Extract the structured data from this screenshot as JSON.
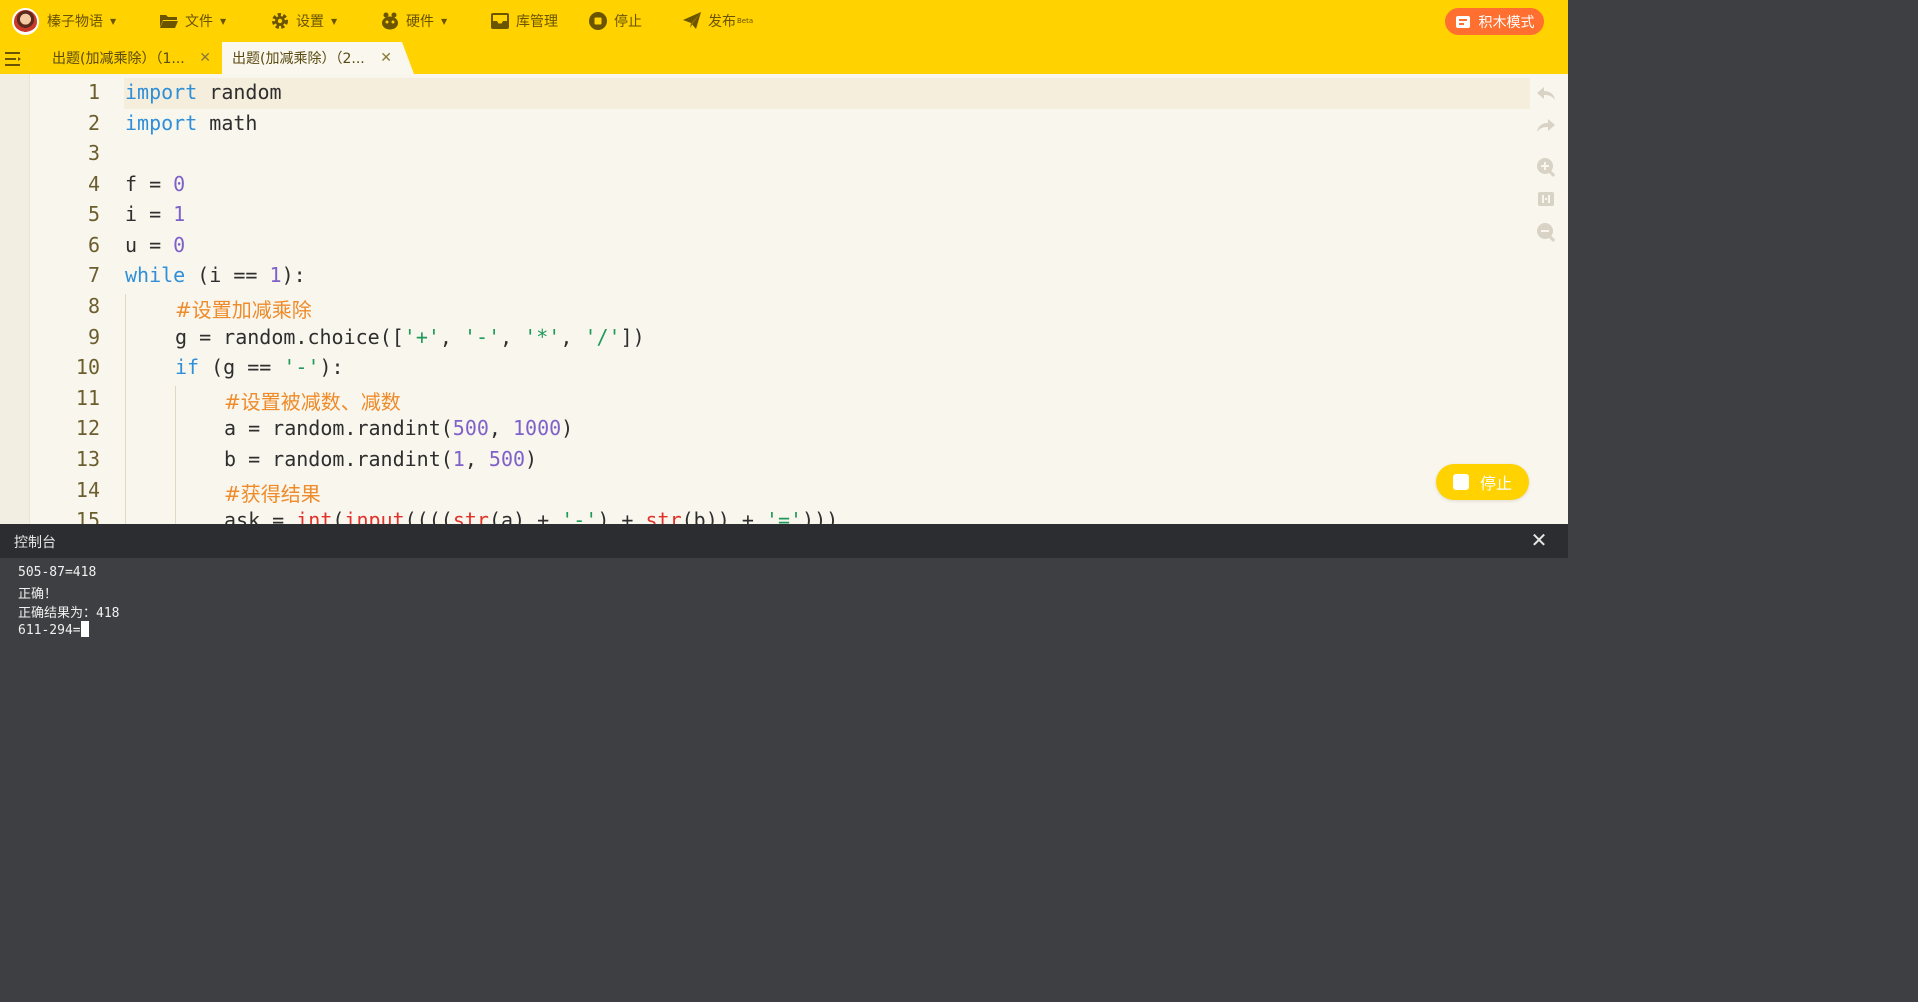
{
  "menubar": {
    "profile": "榛子物语",
    "file": "文件",
    "settings": "设置",
    "hardware": "硬件",
    "library": "库管理",
    "stop": "停止",
    "publish": "发布",
    "publish_badge": "Beta",
    "block_mode": "积木模式"
  },
  "tabs": [
    {
      "label": "出题(加减乘除）（1..."
    },
    {
      "label": "出题(加减乘除）（2..."
    }
  ],
  "editor": {
    "line_numbers": [
      "1",
      "2",
      "3",
      "4",
      "5",
      "6",
      "7",
      "8",
      "9",
      "10",
      "11",
      "12",
      "13",
      "14",
      "15"
    ],
    "stop_button": "停止"
  },
  "code": {
    "l1": {
      "kw": "import",
      "rest": " random"
    },
    "l2": {
      "kw": "import",
      "rest": " math"
    },
    "l4": {
      "a": "f = ",
      "n": "0"
    },
    "l5": {
      "a": "i = ",
      "n": "1"
    },
    "l6": {
      "a": "u = ",
      "n": "0"
    },
    "l7": {
      "kw": "while",
      "a": " (i == ",
      "n": "1",
      "b": "):"
    },
    "l8": {
      "cmt": "#设置加减乘除"
    },
    "l9": {
      "a": "g = random.choice([",
      "s1": "'+'",
      "c1": ", ",
      "s2": "'-'",
      "c2": ", ",
      "s3": "'*'",
      "c3": ", ",
      "s4": "'/'",
      "b": "])"
    },
    "l10": {
      "kw": "if",
      "a": " (g == ",
      "s": "'-'",
      "b": "):"
    },
    "l11": {
      "cmt": "#设置被减数、减数"
    },
    "l12": {
      "a": "a = random.randint(",
      "n1": "500",
      "c": ", ",
      "n2": "1000",
      "b": ")"
    },
    "l13": {
      "a": "b = random.randint(",
      "n1": "1",
      "c": ", ",
      "n2": "500",
      "b": ")"
    },
    "l14": {
      "cmt": "#获得结果"
    },
    "l15": {
      "a": "ask = ",
      "f1": "int",
      "p1": "(",
      "f2": "input",
      "p2": "((((",
      "f3": "str",
      "p3": "(a) + ",
      "s1": "'-'",
      "p4": ") + ",
      "f4": "str",
      "p5": "(b)) + ",
      "s2": "'='",
      "p6": ")))"
    }
  },
  "console": {
    "title": "控制台",
    "lines": [
      "505-87=418",
      "正确！",
      "正确结果为：418",
      "611-294="
    ]
  },
  "colors": {
    "accent_yellow": "#ffd200",
    "block_mode_orange": "#ff6f2f",
    "keyword": "#2f8fd8",
    "number": "#7e62c9",
    "string": "#1f9a5a",
    "comment": "#ee8b2a",
    "builtin": "#e0322a"
  }
}
